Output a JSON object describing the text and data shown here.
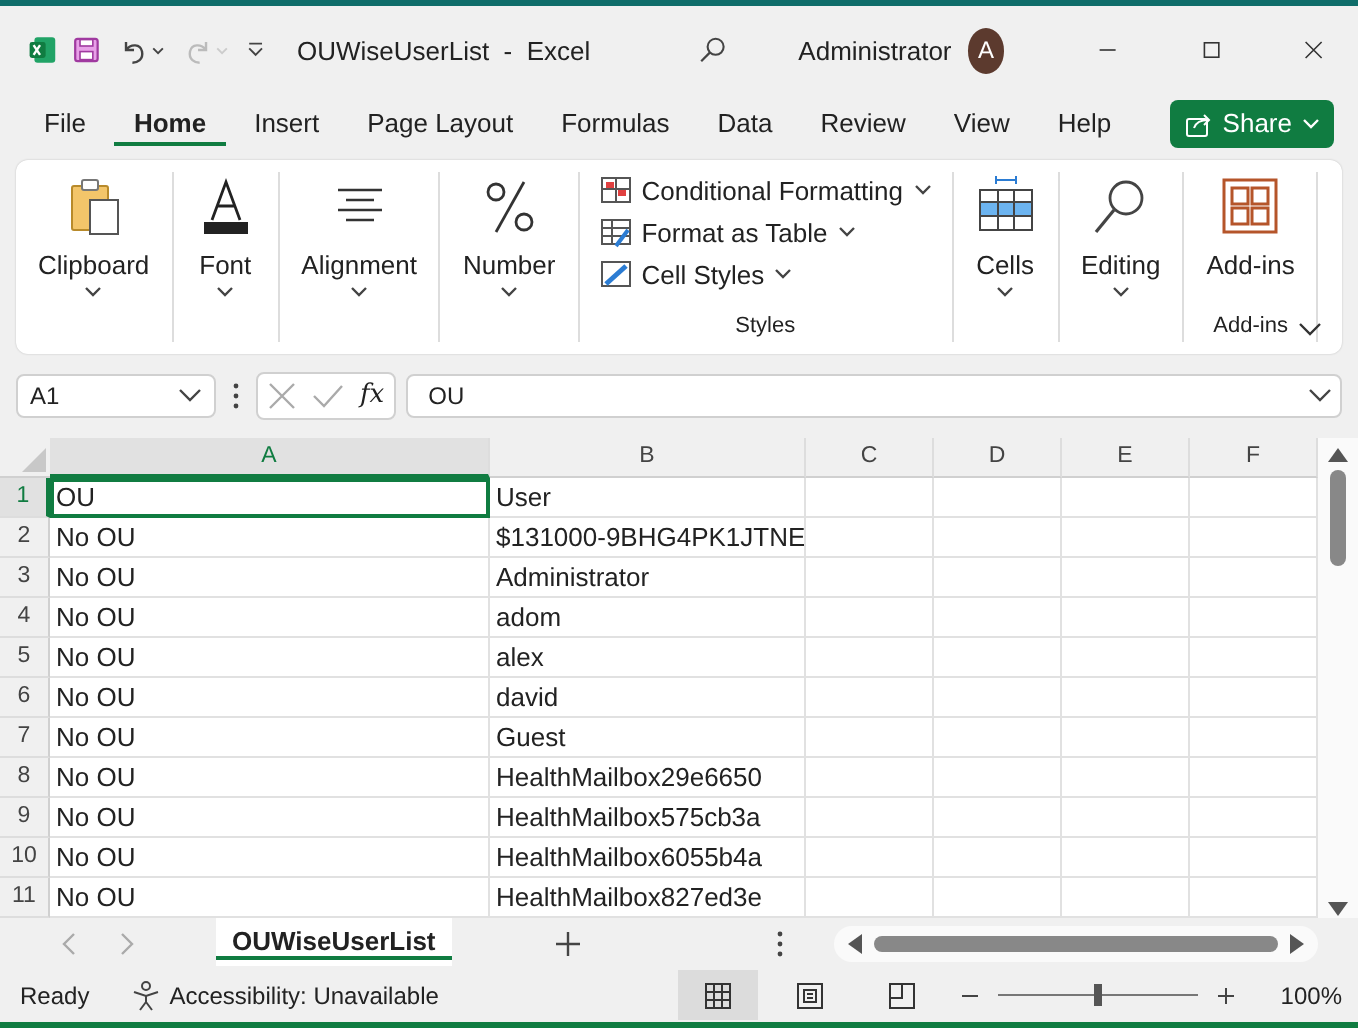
{
  "title_bar": {
    "document": "OUWiseUserList  -  Excel",
    "user": "Administrator",
    "avatar": "A"
  },
  "menu_tabs": [
    {
      "label": "File",
      "selected": false
    },
    {
      "label": "Home",
      "selected": true
    },
    {
      "label": "Insert",
      "selected": false
    },
    {
      "label": "Page Layout",
      "selected": false
    },
    {
      "label": "Formulas",
      "selected": false
    },
    {
      "label": "Data",
      "selected": false
    },
    {
      "label": "Review",
      "selected": false
    },
    {
      "label": "View",
      "selected": false
    },
    {
      "label": "Help",
      "selected": false
    }
  ],
  "share": "Share",
  "ribbon": [
    {
      "kind": "large",
      "label": "Clipboard",
      "dropdown": true
    },
    {
      "kind": "large",
      "label": "Font",
      "dropdown": true
    },
    {
      "kind": "large",
      "label": "Alignment",
      "dropdown": true
    },
    {
      "kind": "large",
      "label": "Number",
      "dropdown": true
    },
    {
      "kind": "list",
      "items": [
        {
          "label": "Conditional Formatting"
        },
        {
          "label": "Format as Table"
        },
        {
          "label": "Cell Styles"
        }
      ],
      "group_label": "Styles"
    },
    {
      "kind": "large",
      "label": "Cells",
      "dropdown": true
    },
    {
      "kind": "large",
      "label": "Editing",
      "dropdown": true
    },
    {
      "kind": "large",
      "label": "Add-ins",
      "dropdown": false,
      "group_label": "Add-ins"
    }
  ],
  "formula_bar": {
    "name_box": "A1",
    "function_button": "fx",
    "formula": "OU"
  },
  "sheet": {
    "columns": [
      {
        "label": "A",
        "selected": true
      },
      {
        "label": "B",
        "selected": false
      },
      {
        "label": "C",
        "selected": false
      },
      {
        "label": "D",
        "selected": false
      },
      {
        "label": "E",
        "selected": false
      },
      {
        "label": "F",
        "selected": false
      }
    ],
    "rows": [
      {
        "number": "1",
        "selected": true,
        "cells": [
          {
            "text": "OU",
            "selected": true
          },
          {
            "text": "User",
            "selected": false
          }
        ]
      },
      {
        "number": "2",
        "selected": false,
        "cells": [
          {
            "text": "No OU",
            "selected": false
          },
          {
            "text": "$131000-9BHG4PK1JTNE",
            "selected": false
          }
        ]
      },
      {
        "number": "3",
        "selected": false,
        "cells": [
          {
            "text": "No OU",
            "selected": false
          },
          {
            "text": "Administrator",
            "selected": false
          }
        ]
      },
      {
        "number": "4",
        "selected": false,
        "cells": [
          {
            "text": "No OU",
            "selected": false
          },
          {
            "text": "adom",
            "selected": false
          }
        ]
      },
      {
        "number": "5",
        "selected": false,
        "cells": [
          {
            "text": "No OU",
            "selected": false
          },
          {
            "text": "alex",
            "selected": false
          }
        ]
      },
      {
        "number": "6",
        "selected": false,
        "cells": [
          {
            "text": "No OU",
            "selected": false
          },
          {
            "text": "david",
            "selected": false
          }
        ]
      },
      {
        "number": "7",
        "selected": false,
        "cells": [
          {
            "text": "No OU",
            "selected": false
          },
          {
            "text": "Guest",
            "selected": false
          }
        ]
      },
      {
        "number": "8",
        "selected": false,
        "cells": [
          {
            "text": "No OU",
            "selected": false
          },
          {
            "text": "HealthMailbox29e6650",
            "selected": false
          }
        ]
      },
      {
        "number": "9",
        "selected": false,
        "cells": [
          {
            "text": "No OU",
            "selected": false
          },
          {
            "text": "HealthMailbox575cb3a",
            "selected": false
          }
        ]
      },
      {
        "number": "10",
        "selected": false,
        "cells": [
          {
            "text": "No OU",
            "selected": false
          },
          {
            "text": "HealthMailbox6055b4a",
            "selected": false
          }
        ]
      },
      {
        "number": "11",
        "selected": false,
        "cells": [
          {
            "text": "No OU",
            "selected": false
          },
          {
            "text": "HealthMailbox827ed3e",
            "selected": false
          }
        ]
      }
    ]
  },
  "sheet_tabs": [
    {
      "label": "OUWiseUserList",
      "selected": true
    }
  ],
  "status_bar": {
    "state": "Ready",
    "accessibility": "Accessibility: Unavailable",
    "views": [
      {
        "kind": "normal",
        "selected": true
      },
      {
        "kind": "page_layout",
        "selected": false
      },
      {
        "kind": "page_break",
        "selected": false
      }
    ],
    "zoom": {
      "level": 0.5,
      "reading": "100%"
    }
  }
}
